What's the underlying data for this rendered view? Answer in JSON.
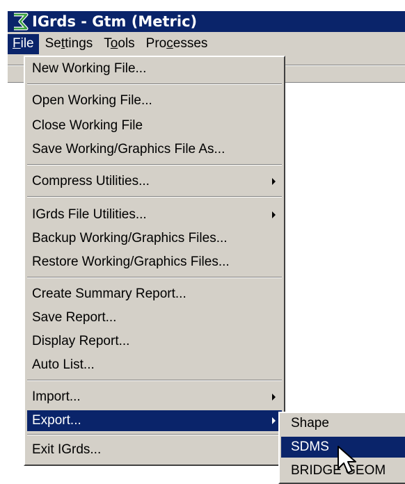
{
  "window": {
    "title": "IGrds - Gtm (Metric)",
    "app_icon": "igrds-logo-icon"
  },
  "menubar": {
    "items": [
      {
        "label_underlined": "F",
        "label_rest": "ile",
        "active": true
      },
      {
        "label_pre": "Se",
        "label_underlined": "t",
        "label_rest": "tings"
      },
      {
        "label_pre": "T",
        "label_underlined": "o",
        "label_rest": "ols"
      },
      {
        "label_pre": "Pro",
        "label_underlined": "c",
        "label_rest": "esses"
      }
    ]
  },
  "file_menu": {
    "items": [
      {
        "label": "New Working File..."
      },
      {
        "label": "Open Working File..."
      },
      {
        "label": "Close Working File"
      },
      {
        "label": "Save Working/Graphics File As..."
      },
      {
        "label": "Compress Utilities...",
        "submenu": true
      },
      {
        "label": "IGrds File Utilities...",
        "submenu": true
      },
      {
        "label": "Backup Working/Graphics Files..."
      },
      {
        "label": "Restore Working/Graphics Files..."
      },
      {
        "label": "Create Summary Report..."
      },
      {
        "label": "Save Report..."
      },
      {
        "label": "Display Report..."
      },
      {
        "label": "Auto List..."
      },
      {
        "label": "Import...",
        "submenu": true
      },
      {
        "label": "Export...",
        "submenu": true,
        "active": true
      },
      {
        "label": "Exit IGrds..."
      }
    ]
  },
  "export_submenu": {
    "items": [
      {
        "label": "Shape"
      },
      {
        "label": "SDMS",
        "active": true
      },
      {
        "label": "BRIDGE GEOM"
      }
    ]
  },
  "colors": {
    "highlight": "#0a246a",
    "face": "#d4d0c8",
    "text": "#000000",
    "highlight_text": "#ffffff"
  }
}
